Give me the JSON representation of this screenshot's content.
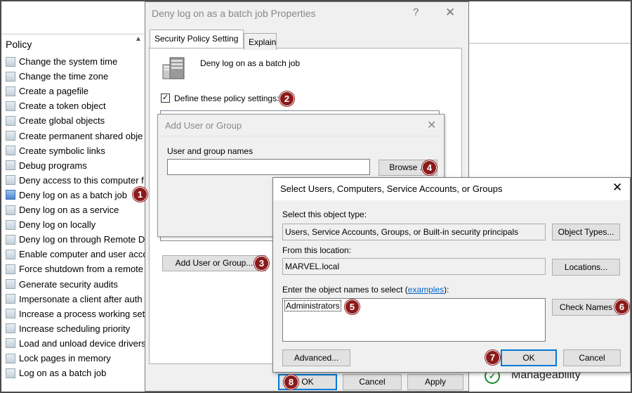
{
  "policy_list": {
    "header": "Policy",
    "items": [
      "Change the system time",
      "Change the time zone",
      "Create a pagefile",
      "Create a token object",
      "Create global objects",
      "Create permanent shared obje",
      "Create symbolic links",
      "Debug programs",
      "Deny access to this computer f",
      "Deny log on as a batch job",
      "Deny log on as a service",
      "Deny log on locally",
      "Deny log on through Remote D",
      "Enable computer and user acco",
      "Force shutdown from a remote",
      "Generate security audits",
      "Impersonate a client after auth",
      "Increase a process working set",
      "Increase scheduling priority",
      "Load and unload device drivers",
      "Lock pages in memory",
      "Log on as a batch job"
    ],
    "selected_index": 9
  },
  "right_pane": {
    "manageability_label": "Manageability"
  },
  "properties_dialog": {
    "title": "Deny log on as a batch job Properties",
    "help": "?",
    "close": "✕",
    "tabs": [
      "Security Policy Setting",
      "Explain"
    ],
    "policy_name": "Deny log on as a batch job",
    "define_checked": true,
    "define_label": "Define these policy settings:",
    "add_button": "Add User or Group...",
    "ok": "OK",
    "cancel": "Cancel",
    "apply": "Apply"
  },
  "add_user_dialog": {
    "title": "Add User or Group",
    "close": "✕",
    "names_label": "User and group names",
    "names_value": "",
    "browse": "Browse ..."
  },
  "select_dialog": {
    "title": "Select Users, Computers, Service Accounts, or Groups",
    "close": "✕",
    "object_type_label": "Select this object type:",
    "object_type_value": "Users, Service Accounts, Groups, or Built-in security principals",
    "object_types_button": "Object Types...",
    "location_label": "From this location:",
    "location_value": "MARVEL.local",
    "locations_button": "Locations...",
    "names_label_prefix": "Enter the object names to select (",
    "names_label_link": "examples",
    "names_label_suffix": "):",
    "names_value": "Administrators",
    "check_names": "Check Names",
    "advanced": "Advanced...",
    "ok": "OK",
    "cancel": "Cancel"
  },
  "callouts": [
    "1",
    "2",
    "3",
    "4",
    "5",
    "6",
    "7",
    "8"
  ],
  "colors": {
    "badge": "#8b1a1a",
    "accent_border": "#0078d7",
    "dialog_bg": "#f0f0f0",
    "link": "#0066cc"
  }
}
